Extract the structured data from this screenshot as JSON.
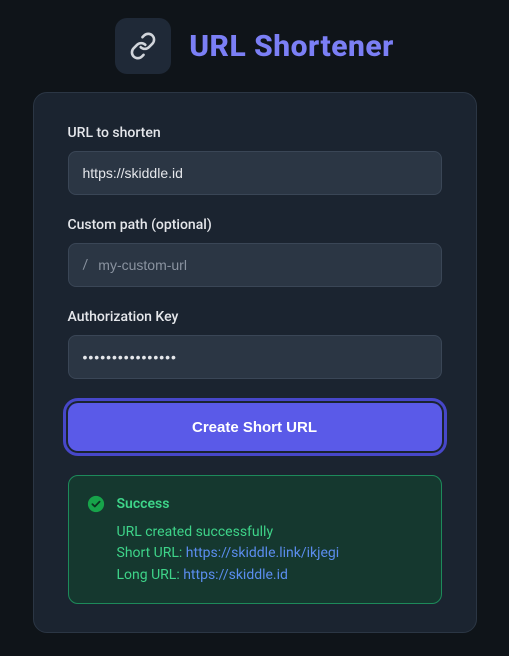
{
  "header": {
    "title": "URL Shortener"
  },
  "form": {
    "url_label": "URL to shorten",
    "url_value": "https://skiddle.id",
    "path_label": "Custom path (optional)",
    "path_prefix": "/",
    "path_placeholder": "my-custom-url",
    "path_value": "",
    "auth_label": "Authorization Key",
    "auth_value": "••••••••••••••••",
    "submit_label": "Create Short URL"
  },
  "result": {
    "title": "Success",
    "message": "URL created successfully",
    "short_label": "Short URL:",
    "short_url": "https://skiddle.link/ikjegi",
    "long_label": "Long URL:",
    "long_url": "https://skiddle.id"
  },
  "colors": {
    "accent": "#5a5ae8",
    "title": "#7b7ff5",
    "success": "#3ed489",
    "link": "#5b8def"
  }
}
